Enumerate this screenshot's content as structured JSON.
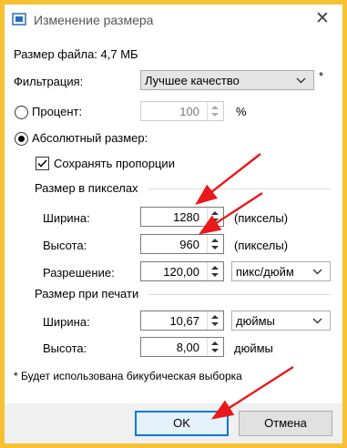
{
  "window": {
    "title": "Изменение размера",
    "close": "✕"
  },
  "file_size_label": "Размер файла: 4,7 МБ",
  "filter": {
    "label": "Фильтрация:",
    "value": "Лучшее качество",
    "asterisk": "*"
  },
  "percent": {
    "label": "Процент:",
    "value": "100",
    "unit": "%",
    "selected": false
  },
  "absolute": {
    "label": "Абсолютный размер:",
    "selected": true
  },
  "keep_proportions": {
    "label": "Сохранять пропорции",
    "checked": true
  },
  "pixel_group": {
    "title": "Размер в пикселах",
    "width_label": "Ширина:",
    "width_value": "1280",
    "width_unit": "(пикселы)",
    "height_label": "Высота:",
    "height_value": "960",
    "height_unit": "(пикселы)",
    "resolution_label": "Разрешение:",
    "resolution_value": "120,00",
    "resolution_unit": "пикс/дюйм"
  },
  "print_group": {
    "title": "Размер при печати",
    "width_label": "Ширина:",
    "width_value": "10,67",
    "width_unit": "дюймы",
    "height_label": "Высота:",
    "height_value": "8,00",
    "height_unit": "дюймы"
  },
  "footnote": "* Будет использована бикубическая выборка",
  "buttons": {
    "ok": "OK",
    "cancel": "Отмена"
  },
  "colors": {
    "frame": "#f6c233",
    "annotation_arrow": "#e8191b",
    "default_button_border": "#0078d7"
  }
}
